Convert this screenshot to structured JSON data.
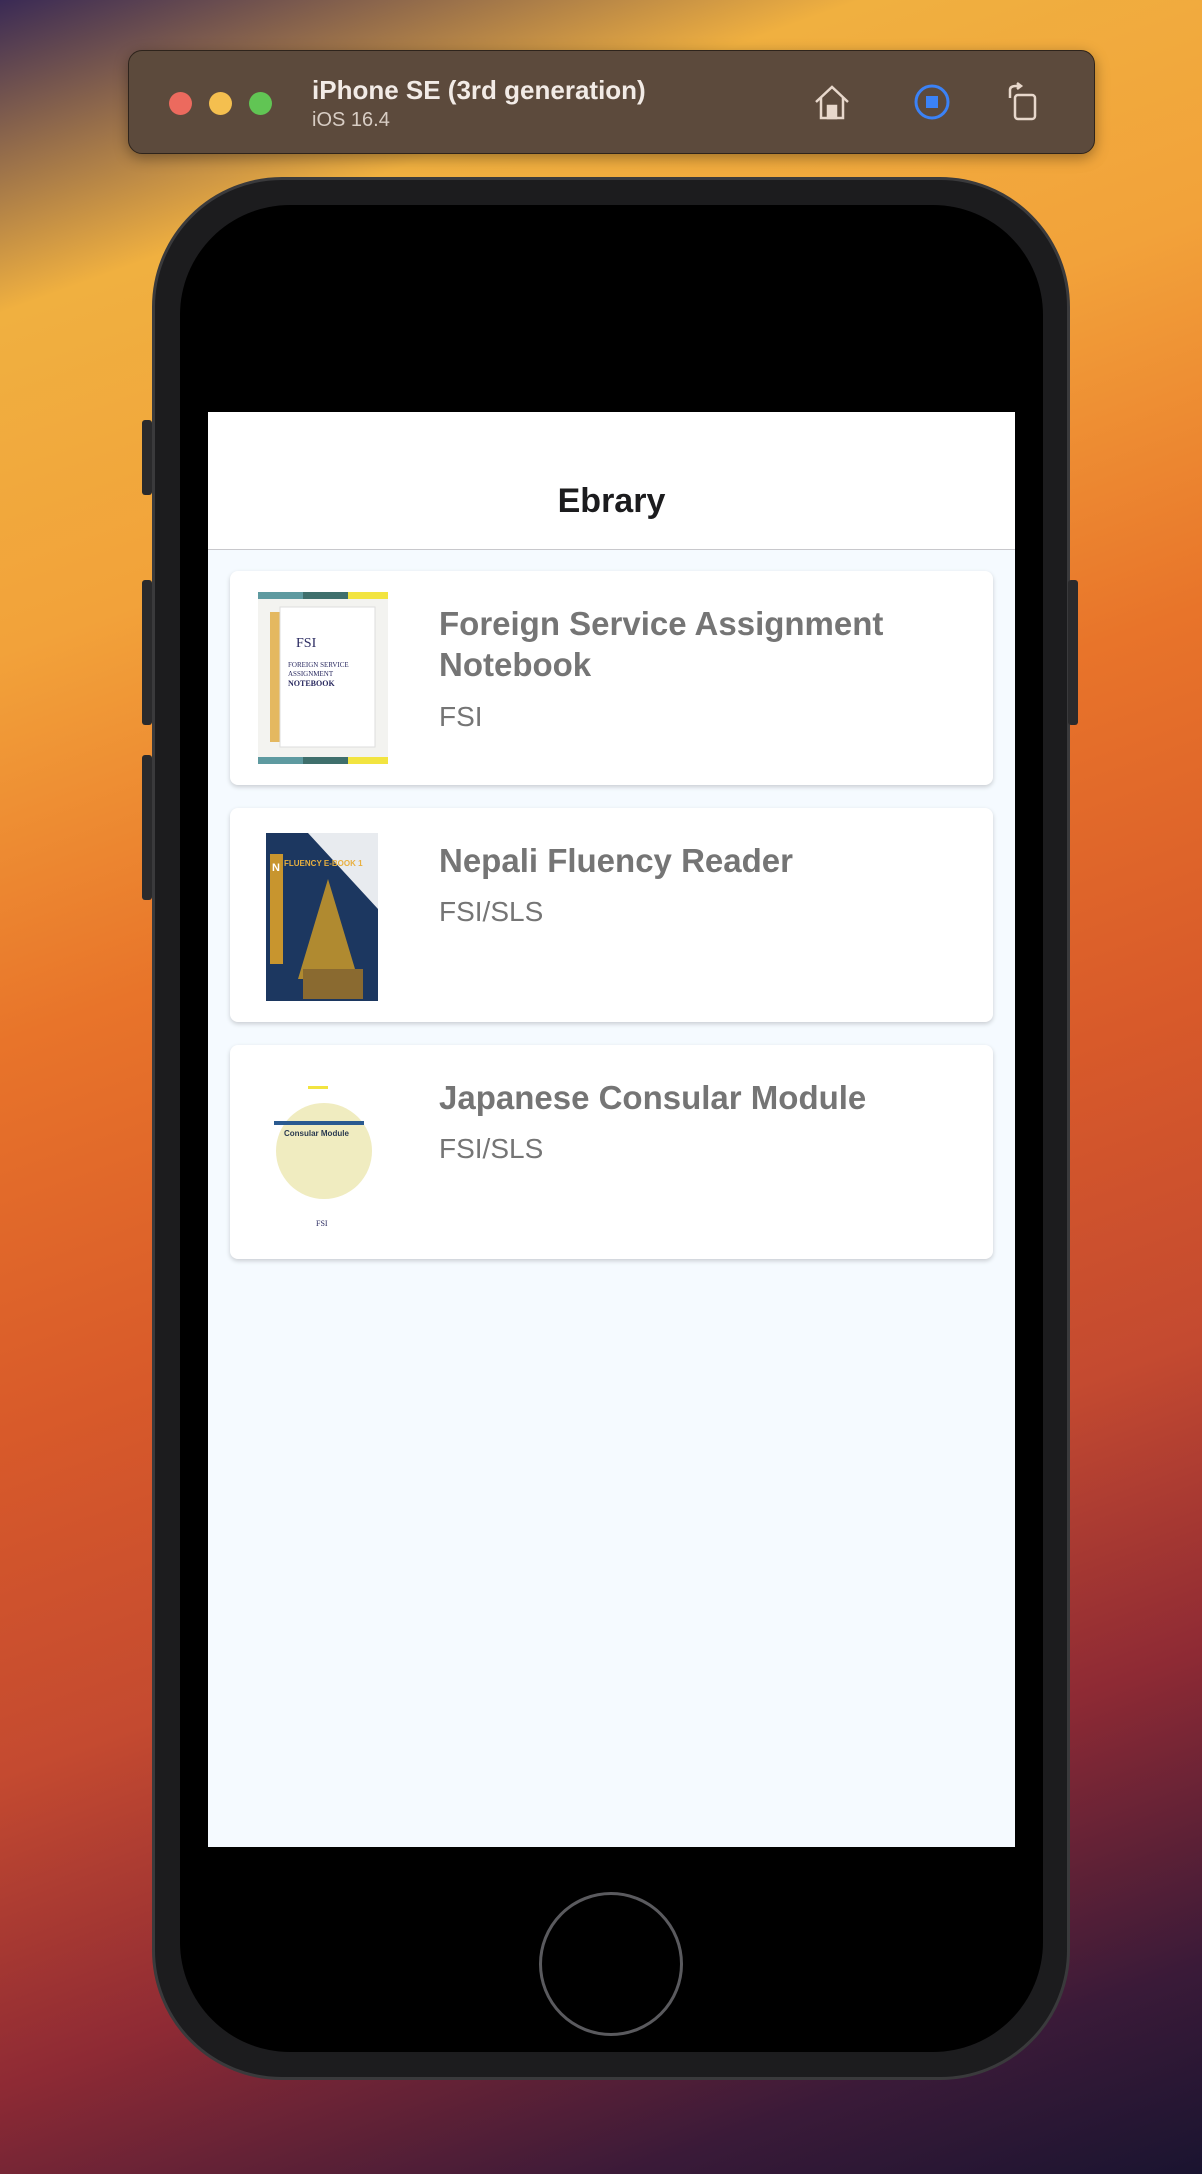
{
  "simulator": {
    "device": "iPhone SE (3rd generation)",
    "os": "iOS 16.4",
    "icons": [
      "home-icon",
      "stop-record-icon",
      "rotate-icon"
    ],
    "accent": "#3b82f6"
  },
  "app": {
    "title": "Ebrary",
    "books": [
      {
        "title": "Foreign Service Assignment Notebook",
        "author": "FSI",
        "cover": "FSI Foreign Service Assignment Notebook cover"
      },
      {
        "title": "Nepali Fluency Reader",
        "author": "FSI/SLS",
        "cover": "Nepali Fluency E-Book 1 cover"
      },
      {
        "title": "Japanese Consular Module",
        "author": "FSI/SLS",
        "cover": "Consular Module cover"
      }
    ]
  }
}
